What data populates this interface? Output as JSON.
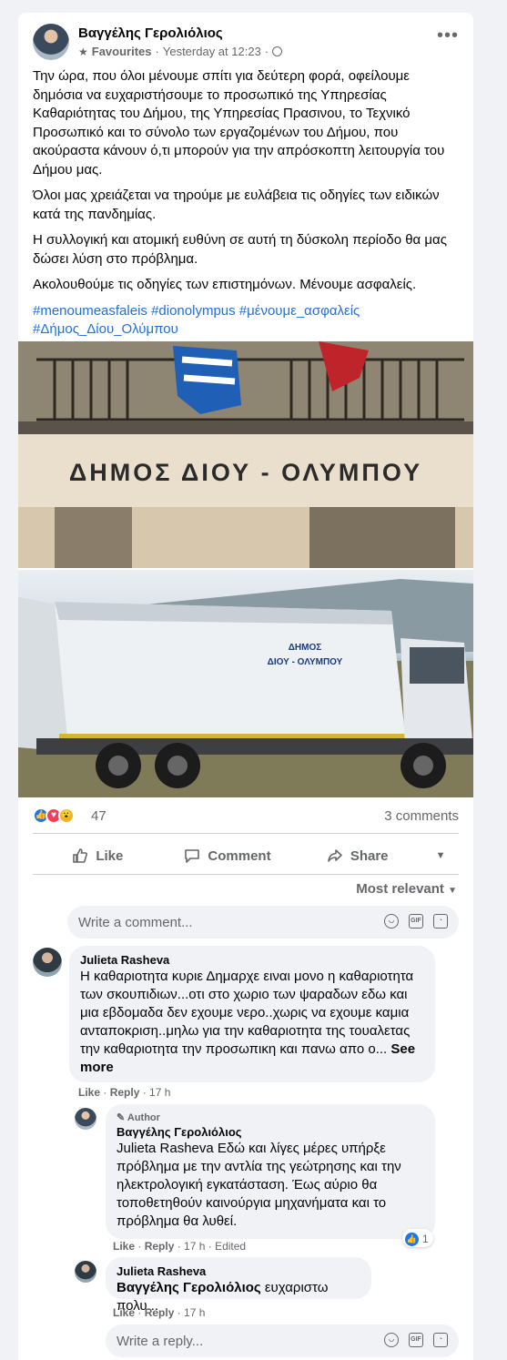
{
  "post": {
    "author": "Βαγγέλης Γερολιόλιος",
    "audience": "Favourites",
    "time": "Yesterday at 12:23",
    "paragraphs": [
      "Την ώρα, που όλοι μένουμε σπίτι για δεύτερη φορά, οφείλουμε δημόσια να ευχαριστήσουμε το προσωπικό της Υπηρεσίας Καθαριότητας του Δήμου, της Υπηρεσίας Πρασινου, το Τεχνικό Προσωπικό και το σύνολο των εργαζομένων του Δήμου, που ακούραστα κάνουν ό,τι μπορούν για την απρόσκοπτη λειτουργία του Δήμου μας.",
      "Όλοι μας χρειάζεται να τηρούμε με ευλάβεια τις οδηγίες των ειδικών κατά της πανδημίας.",
      "Η συλλογική και ατομική ευθύνη σε αυτή τη δύσκολη περίοδο θα μας δώσει λύση στο πρόβλημα.",
      "Ακολουθούμε τις οδηγίες των επιστημόνων. Μένουμε ασφαλείς."
    ],
    "hashtags": "#menoumeasfaleis #dionolympus #μένουμε_ασφαλείς #Δήμος_Δίου_Ολύμπου",
    "photo1_sign": "ΔΗΜΟΣ ΔΙΟΥ - ΟΛΥΜΠΟΥ",
    "photo2_sign_line1": "ΔΗΜΟΣ",
    "photo2_sign_line2": "ΔΙΟΥ - ΟΛΥΜΠΟΥ",
    "reactions_count": "47",
    "comments_count": "3 comments"
  },
  "actions": {
    "like": "Like",
    "comment": "Comment",
    "share": "Share"
  },
  "sort_label": "Most relevant",
  "write_placeholder": "Write a comment...",
  "write_reply_placeholder": "Write a reply...",
  "comments": [
    {
      "name": "Julieta Rasheva",
      "text": "Η καθαριοτητα κυριε Δημαρχε ειναι μονο η καθαριοτητα των σκουπιδιων...οτι στο χωριο των ψαραδων εδω και μια εβδομαδα δεν εχουμε νερο..χωρις να εχουμε καμια ανταποκριση..μηλω για την καθαριοτητα της τουαλετας την καθαριοτητα την προσωπικη και πανω απο ο...",
      "see_more": "See more",
      "like": "Like",
      "reply": "Reply",
      "time": "17 h"
    },
    {
      "badge": "Author",
      "name": "Βαγγέλης Γερολιόλιος",
      "text": "Julieta Rasheva Εδώ και λίγες μέρες υπήρξε πρόβλημα με την αντλία της γεώτρησης και την ηλεκτρολογική εγκατάσταση. Έως αύριο θα τοποθετηθούν καινούργια μηχανήματα και το πρόβλημα θα λυθεί.",
      "like": "Like",
      "reply": "Reply",
      "time": "17 h",
      "edited": "Edited",
      "likes": "1"
    },
    {
      "name": "Julieta Rasheva",
      "tag": "Βαγγέλης Γερολιόλιος",
      "text": "ευχαριστω πολυ...",
      "like": "Like",
      "reply": "Reply",
      "time": "17 h"
    }
  ],
  "colors": {
    "link": "#216fdb",
    "muted": "#65676b",
    "like_blue": "#1877f2"
  }
}
